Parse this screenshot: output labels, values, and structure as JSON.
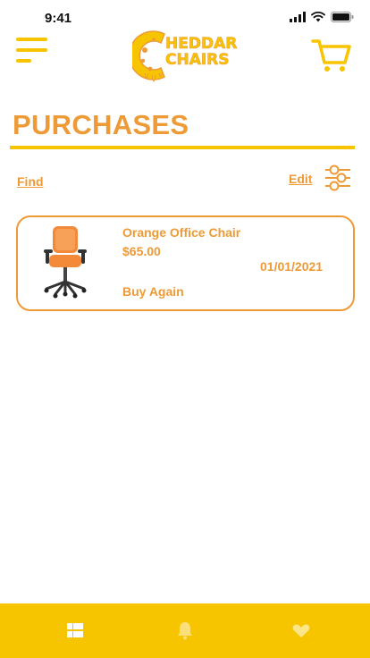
{
  "status_bar": {
    "time": "9:41",
    "icons": [
      "signal-icon",
      "wifi-icon",
      "battery-icon"
    ]
  },
  "header": {
    "menu_icon": "hamburger-menu-icon",
    "logo_line1": "HEDDAR",
    "logo_line2": "CHAIRS",
    "logo_letter": "C",
    "cart_icon": "shopping-cart-icon"
  },
  "page": {
    "title": "PURCHASES"
  },
  "toolbar": {
    "find_label": "Find",
    "edit_label": "Edit",
    "filter_icon": "sliders-icon"
  },
  "purchases": [
    {
      "name": "Orange Office Chair",
      "price": "$65.00",
      "date": "01/01/2021",
      "action": "Buy Again",
      "image": "orange-office-chair"
    }
  ],
  "bottom_nav": {
    "items": [
      "grid-list-icon",
      "bell-icon",
      "heart-icon"
    ]
  },
  "colors": {
    "accent_orange": "#ee9a36",
    "brand_yellow": "#f7c500",
    "background": "#ffffff"
  }
}
